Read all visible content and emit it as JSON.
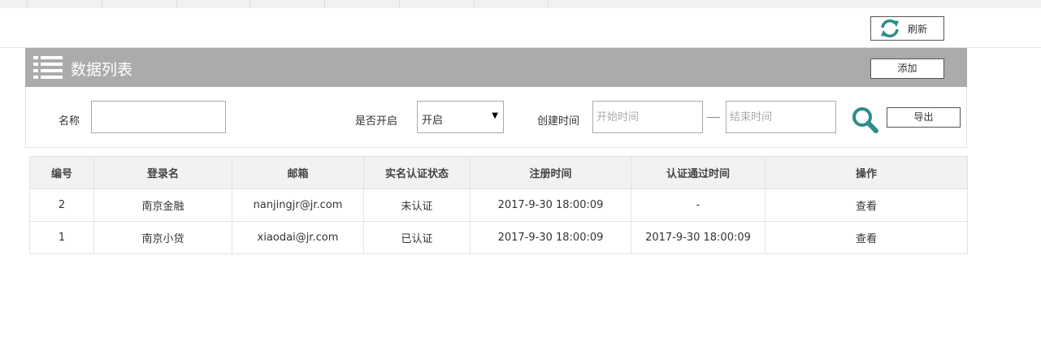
{
  "toolbar": {
    "refresh_label": "刷新"
  },
  "panel": {
    "title": "数据列表",
    "add_label": "添加"
  },
  "filter": {
    "name_label": "名称",
    "name_value": "",
    "enabled_label": "是否开启",
    "enabled_value": "开启",
    "created_label": "创建时间",
    "start_placeholder": "开始时间",
    "end_placeholder": "结束时间",
    "export_label": "导出"
  },
  "table": {
    "headers": [
      "编号",
      "登录名",
      "邮箱",
      "实名认证状态",
      "注册时间",
      "认证通过时间",
      "操作"
    ],
    "rows": [
      [
        "2",
        "南京金融",
        "nanjingjr@jr.com",
        "未认证",
        "2017-9-30 18:00:09",
        "-",
        "查看"
      ],
      [
        "1",
        "南京小贷",
        "xiaodai@jr.com",
        "已认证",
        "2017-9-30 18:00:09",
        "2017-9-30 18:00:09",
        "查看"
      ]
    ]
  },
  "colors": {
    "accent": "#2e8b8b",
    "header_bar": "#ababab"
  },
  "icons": {
    "refresh": "refresh-icon",
    "list": "list-icon",
    "search": "search-icon"
  }
}
